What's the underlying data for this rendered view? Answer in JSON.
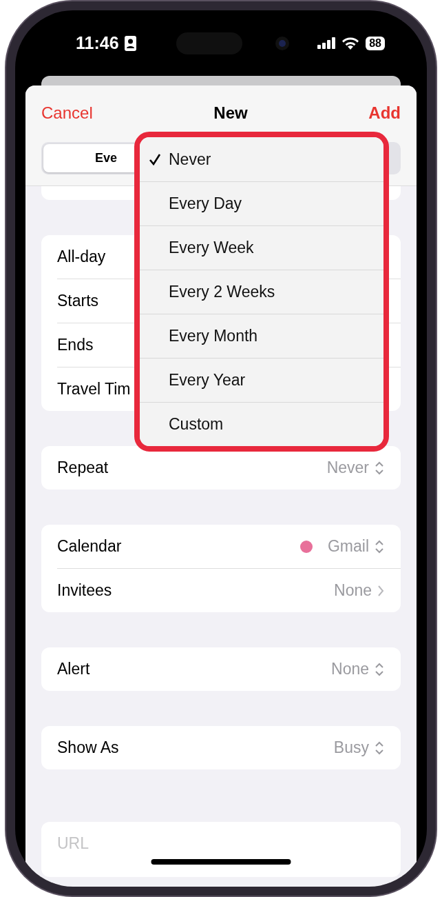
{
  "status_bar": {
    "time": "11:46",
    "battery": "88"
  },
  "nav": {
    "cancel": "Cancel",
    "title": "New",
    "add": "Add"
  },
  "segmented": {
    "segments": [
      {
        "label": "Eve",
        "selected": true
      }
    ]
  },
  "groups": [
    {
      "rows": [
        {
          "label": "All-day"
        },
        {
          "label": "Starts"
        },
        {
          "label": "Ends"
        },
        {
          "label": "Travel Tim"
        }
      ]
    },
    {
      "rows": [
        {
          "label": "Repeat",
          "value": "Never",
          "kind": "updown"
        }
      ]
    },
    {
      "rows": [
        {
          "label": "Calendar",
          "value": "Gmail",
          "kind": "updown",
          "color": "#e8709a"
        },
        {
          "label": "Invitees",
          "value": "None",
          "kind": "chevron"
        }
      ]
    },
    {
      "rows": [
        {
          "label": "Alert",
          "value": "None",
          "kind": "updown"
        }
      ]
    },
    {
      "rows": [
        {
          "label": "Show As",
          "value": "Busy",
          "kind": "updown"
        }
      ]
    }
  ],
  "url_field": {
    "placeholder": "URL"
  },
  "repeat_menu": {
    "items": [
      {
        "label": "Never",
        "selected": true
      },
      {
        "label": "Every Day",
        "selected": false
      },
      {
        "label": "Every Week",
        "selected": false
      },
      {
        "label": "Every 2 Weeks",
        "selected": false
      },
      {
        "label": "Every Month",
        "selected": false
      },
      {
        "label": "Every Year",
        "selected": false
      },
      {
        "label": "Custom",
        "selected": false
      }
    ]
  }
}
